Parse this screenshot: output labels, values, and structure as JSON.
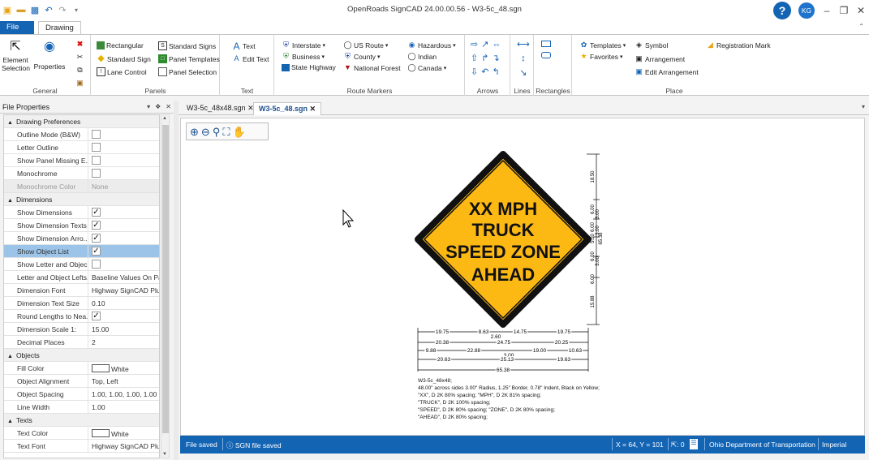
{
  "window": {
    "title": "OpenRoads SignCAD 24.00.00.56 - W3-5c_48.sgn",
    "user_initials": "KG",
    "help_glyph": "?"
  },
  "ribbon_tabs": {
    "file": "File",
    "drawing": "Drawing"
  },
  "ribbon": {
    "general": {
      "label": "General",
      "element_selection": "Element Selection",
      "properties": "Properties"
    },
    "panels": {
      "label": "Panels",
      "rectangular": "Rectangular",
      "standard_sign": "Standard Sign",
      "lane_control": "Lane Control",
      "standard_signs": "Standard Signs",
      "panel_templates": "Panel Templates",
      "panel_selection": "Panel Selection"
    },
    "text": {
      "label": "Text",
      "text": "Text",
      "edit_text": "Edit Text"
    },
    "route_markers": {
      "label": "Route Markers",
      "interstate": "Interstate",
      "business": "Business",
      "state_highway": "State Highway",
      "us_route": "US Route",
      "county": "County",
      "national_forest": "National Forest",
      "hazardous": "Hazardous",
      "indian": "Indian",
      "canada": "Canada"
    },
    "arrows": {
      "label": "Arrows"
    },
    "lines": {
      "label": "Lines"
    },
    "rectangles": {
      "label": "Rectangles"
    },
    "place": {
      "label": "Place",
      "templates": "Templates",
      "favorites": "Favorites",
      "symbol": "Symbol",
      "arrangement": "Arrangement",
      "edit_arrangement": "Edit Arrangement",
      "registration_mark": "Registration Mark"
    }
  },
  "file_properties": {
    "title": "File Properties",
    "categories": [
      {
        "name": "Drawing Preferences",
        "rows": [
          {
            "name": "Outline Mode (B&W)",
            "type": "check",
            "value": false
          },
          {
            "name": "Letter Outline",
            "type": "check",
            "value": false
          },
          {
            "name": "Show Panel Missing E...",
            "type": "check",
            "value": false
          },
          {
            "name": "Monochrome",
            "type": "check",
            "value": false
          },
          {
            "name": "Monochrome Color",
            "type": "text",
            "value": "None",
            "disabled": true
          }
        ]
      },
      {
        "name": "Dimensions",
        "rows": [
          {
            "name": "Show Dimensions",
            "type": "check",
            "value": true
          },
          {
            "name": "Show Dimension Texts",
            "type": "check",
            "value": true
          },
          {
            "name": "Show Dimension Arro...",
            "type": "check",
            "value": true
          },
          {
            "name": "Show Object List",
            "type": "check",
            "value": true,
            "selected": true
          },
          {
            "name": "Show Letter and Objec...",
            "type": "check",
            "value": false
          },
          {
            "name": "Letter and Object Lefts...",
            "type": "text",
            "value": "Baseline Values On Pa"
          },
          {
            "name": "Dimension Font",
            "type": "text",
            "value": "Highway SignCAD Plus"
          },
          {
            "name": "Dimension Text Size",
            "type": "text",
            "value": "0.10"
          },
          {
            "name": "Round Lengths to Nea...",
            "type": "check",
            "value": true
          },
          {
            "name": "Dimension Scale 1:",
            "type": "text",
            "value": "15.00"
          },
          {
            "name": "Decimal Places",
            "type": "text",
            "value": "2"
          }
        ]
      },
      {
        "name": "Objects",
        "rows": [
          {
            "name": "Fill Color",
            "type": "color",
            "value": "White"
          },
          {
            "name": "Object Alignment",
            "type": "text",
            "value": "Top, Left"
          },
          {
            "name": "Object Spacing",
            "type": "text",
            "value": "1.00, 1.00, 1.00, 1.00"
          },
          {
            "name": "Line Width",
            "type": "text",
            "value": "1.00"
          }
        ]
      },
      {
        "name": "Texts",
        "rows": [
          {
            "name": "Text Color",
            "type": "color",
            "value": "White"
          },
          {
            "name": "Text Font",
            "type": "text",
            "value": "Highway SignCAD Plus"
          }
        ]
      }
    ]
  },
  "doc_tabs": [
    {
      "label": "W3-5c_48x48.sgn",
      "active": false
    },
    {
      "label": "W3-5c_48.sgn",
      "active": true
    }
  ],
  "sign": {
    "lines": [
      "XX MPH",
      "TRUCK",
      "SPEED ZONE",
      "AHEAD"
    ],
    "fill_color": "#FDB913",
    "border_color": "#111111"
  },
  "dimensions": {
    "right": [
      "18.50",
      "6.00",
      "3.00",
      "6.00",
      "3.00",
      "5.00",
      "65.38",
      "6.00",
      "3.00",
      "6.00",
      "15.88"
    ],
    "row1": [
      "19.75",
      "8.63",
      "14.75",
      "19.75"
    ],
    "row1b": "2.60",
    "row2": [
      "20.38",
      "24.75",
      "20.25"
    ],
    "row3": [
      "9.88",
      "22.88",
      "19.00",
      "10.63"
    ],
    "row3b": "3.00",
    "row4": [
      "20.63",
      "25.13",
      "19.63"
    ],
    "row5": "65.38"
  },
  "object_list": [
    "W3-5c_48x48;",
    "48.00\" across sides 3.00\" Radius, 1.25\" Border, 0.78\" Indent, Black on Yellow;",
    "\"XX\",  D 2K 80% spacing; \"MPH\",  D 2K 81% spacing;",
    "\"TRUCK\",  D 2K 100% spacing;",
    "\"SPEED\",  D 2K 80% spacing; \"ZONE\",  D 2K 80% spacing;",
    "\"AHEAD\",  D 2K 80% spacing;"
  ],
  "status": {
    "file_saved": "File saved",
    "sgn_saved": "SGN file saved",
    "coords": "X = 64, Y = 101",
    "count": ": 0",
    "org": "Ohio Department of Transportation",
    "units": "Imperial"
  },
  "colors": {
    "accent": "#1464b4",
    "selection": "#9cc4e8",
    "sign_yellow": "#FDB913"
  }
}
